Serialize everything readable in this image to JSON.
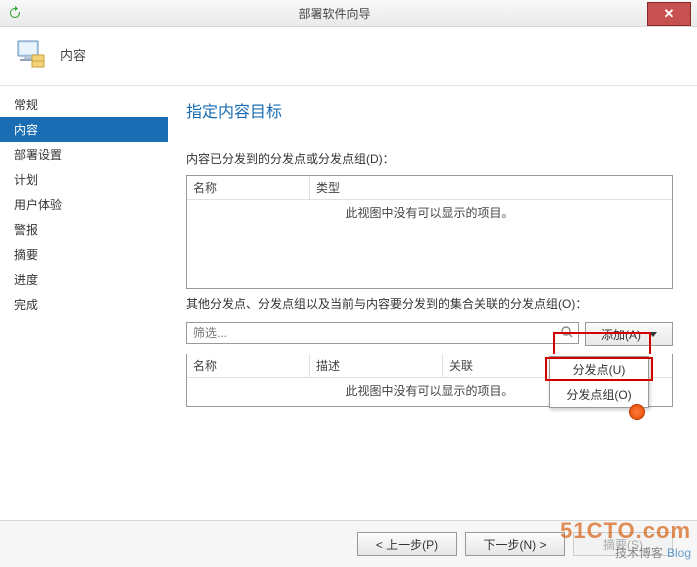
{
  "window": {
    "title": "部署软件向导"
  },
  "header": {
    "label": "内容"
  },
  "sidebar": {
    "items": [
      {
        "label": "常规"
      },
      {
        "label": "内容"
      },
      {
        "label": "部署设置"
      },
      {
        "label": "计划"
      },
      {
        "label": "用户体验"
      },
      {
        "label": "警报"
      },
      {
        "label": "摘要"
      },
      {
        "label": "进度"
      },
      {
        "label": "完成"
      }
    ],
    "active_index": 1
  },
  "main": {
    "heading": "指定内容目标",
    "group1": {
      "label": "内容已分发到的分发点或分发点组(D)：",
      "columns": {
        "name": "名称",
        "type": "类型"
      },
      "empty": "此视图中没有可以显示的项目。"
    },
    "group2": {
      "label": "其他分发点、分发点组以及当前与内容要分发到的集合关联的分发点组(O)：",
      "filter_placeholder": "筛选...",
      "add_label": "添加(A)",
      "columns": {
        "name": "名称",
        "desc": "描述",
        "assoc": "关联"
      },
      "empty": "此视图中没有可以显示的项目。",
      "menu": {
        "dp": "分发点(U)",
        "dpg": "分发点组(O)"
      }
    }
  },
  "footer": {
    "prev": "< 上一步(P)",
    "next": "下一步(N) >",
    "summary": "摘要(S)"
  },
  "watermark": {
    "line1": "51CTO.com",
    "line2a": "技术博客",
    "line2b": "Blog"
  }
}
